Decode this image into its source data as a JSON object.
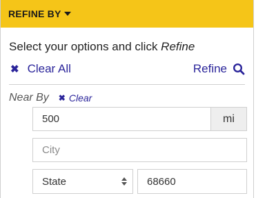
{
  "header": {
    "title": "REFINE BY",
    "icon": "caret-down-icon"
  },
  "instructions": {
    "text": "Select your options and click ",
    "emphasis": "Refine"
  },
  "actions": {
    "clear_all_label": "Clear All",
    "clear_all_icon": "close-icon",
    "refine_label": "Refine",
    "refine_icon": "search-icon"
  },
  "near_by": {
    "label": "Near By",
    "clear_label": "Clear",
    "clear_icon": "close-icon",
    "distance_value": "500",
    "unit": "mi",
    "city_placeholder": "City",
    "state_selected": "State",
    "zip_value": "68660"
  },
  "colors": {
    "header_bg": "#f5c518",
    "link": "#2a249a",
    "border": "#cfcfcf"
  }
}
